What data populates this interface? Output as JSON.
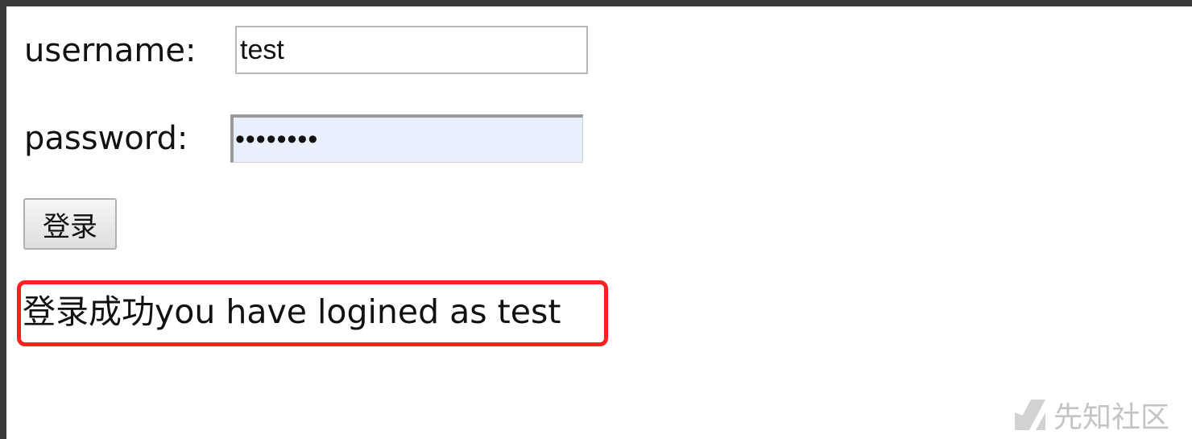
{
  "form": {
    "username_label": "username:",
    "username_value": "test",
    "password_label": "password:",
    "password_value": "test1234",
    "login_button_label": "登录"
  },
  "result": {
    "message": "登录成功you have logined as test"
  },
  "watermark": {
    "text": "先知社区",
    "icon": "xianzhi-logo-icon"
  },
  "colors": {
    "highlight_border": "#ff2020",
    "password_autofill_bg": "#e8f0fd"
  }
}
